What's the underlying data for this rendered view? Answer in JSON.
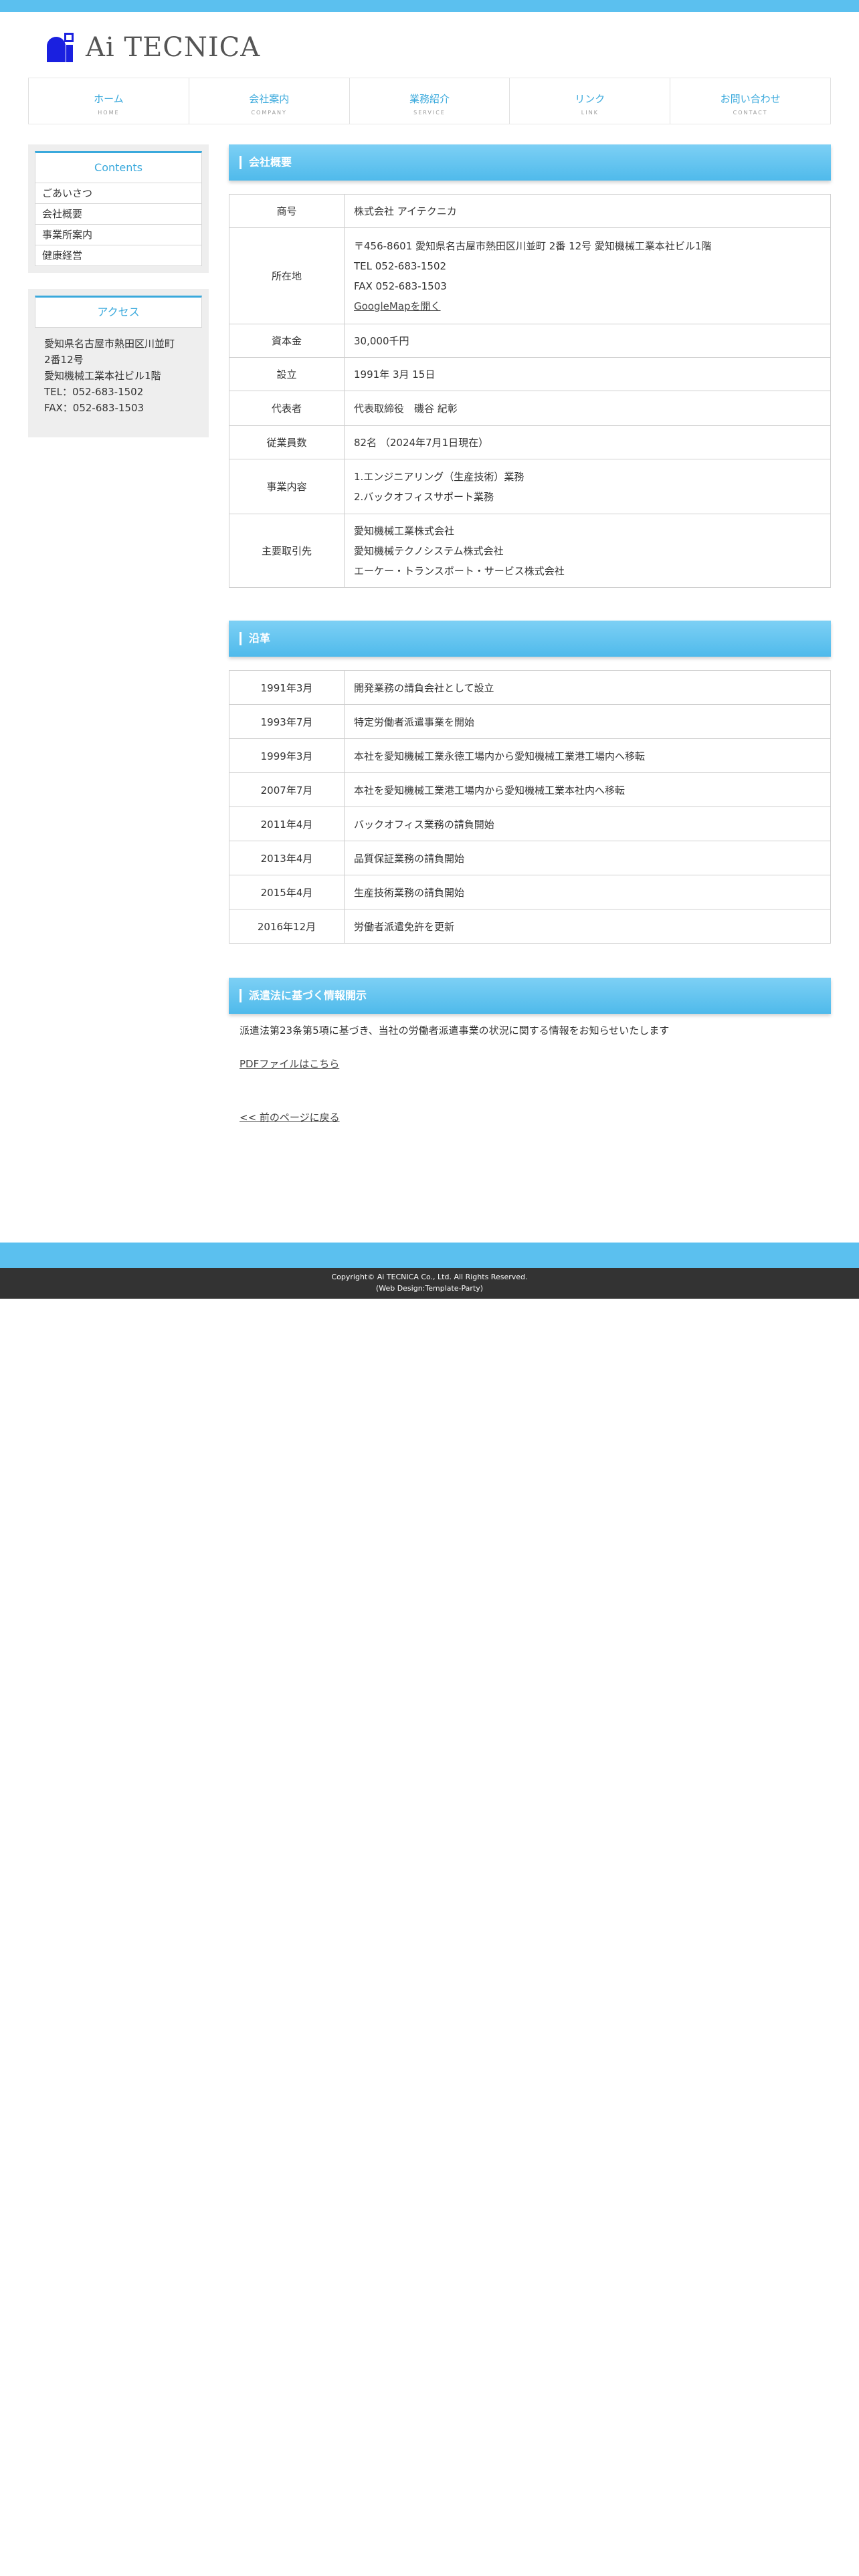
{
  "logo": {
    "text": "Ai TECNICA"
  },
  "nav": [
    {
      "label": "ホーム",
      "sub": "HOME"
    },
    {
      "label": "会社案内",
      "sub": "COMPANY"
    },
    {
      "label": "業務紹介",
      "sub": "SERVICE"
    },
    {
      "label": "リンク",
      "sub": "LINK"
    },
    {
      "label": "お問い合わせ",
      "sub": "CONTACT"
    }
  ],
  "sidebar": {
    "contents_title": "Contents",
    "menu": [
      "ごあいさつ",
      "会社概要",
      "事業所案内",
      "健康経営"
    ],
    "access_title": "アクセス",
    "access_lines": [
      "愛知県名古屋市熱田区川並町",
      "2番12号",
      "愛知機械工業本社ビル1階",
      "TEL：052-683-1502",
      "FAX：052-683-1503"
    ]
  },
  "overview": {
    "heading": "会社概要",
    "rows": [
      {
        "label": "商号",
        "lines": [
          "株式会社 アイテクニカ"
        ]
      },
      {
        "label": "所在地",
        "lines": [
          "〒456-8601 愛知県名古屋市熱田区川並町 2番 12号 愛知機械工業本社ビル1階",
          "TEL 052-683-1502",
          "FAX 052-683-1503"
        ],
        "link": "GoogleMapを開く"
      },
      {
        "label": "資本金",
        "lines": [
          "30,000千円"
        ]
      },
      {
        "label": "設立",
        "lines": [
          "1991年 3月 15日"
        ]
      },
      {
        "label": "代表者",
        "lines": [
          "代表取締役　磯谷 紀彰"
        ]
      },
      {
        "label": "従業員数",
        "lines": [
          "82名 （2024年7月1日現在）"
        ]
      },
      {
        "label": "事業内容",
        "lines": [
          "1.エンジニアリング（生産技術）業務",
          "2.バックオフィスサポート業務"
        ]
      },
      {
        "label": "主要取引先",
        "lines": [
          "愛知機械工業株式会社",
          "愛知機械テクノシステム株式会社",
          "エーケー・トランスポート・サービス株式会社"
        ]
      }
    ]
  },
  "history": {
    "heading": "沿革",
    "rows": [
      {
        "date": "1991年3月",
        "text": "開発業務の請負会社として設立"
      },
      {
        "date": "1993年7月",
        "text": "特定労働者派遣事業を開始"
      },
      {
        "date": "1999年3月",
        "text": "本社を愛知機械工業永徳工場内から愛知機械工業港工場内へ移転"
      },
      {
        "date": "2007年7月",
        "text": "本社を愛知機械工業港工場内から愛知機械工業本社内へ移転"
      },
      {
        "date": "2011年4月",
        "text": "バックオフィス業務の請負開始"
      },
      {
        "date": "2013年4月",
        "text": "品質保証業務の請負開始"
      },
      {
        "date": "2015年4月",
        "text": "生産技術業務の請負開始"
      },
      {
        "date": "2016年12月",
        "text": "労働者派遣免許を更新"
      }
    ]
  },
  "disclosure": {
    "heading": "派遣法に基づく情報開示",
    "text": "派遣法第23条第5項に基づき、当社の労働者派遣事業の状況に関する情報をお知らせいたします",
    "pdf_link": "PDFファイルはこちら"
  },
  "back_link": "<< 前のページに戻る",
  "footer": {
    "copyright": "Copyright© Ai TECNICA Co., Ltd. All Rights Reserved.",
    "credit": "(Web Design:Template-Party)"
  }
}
